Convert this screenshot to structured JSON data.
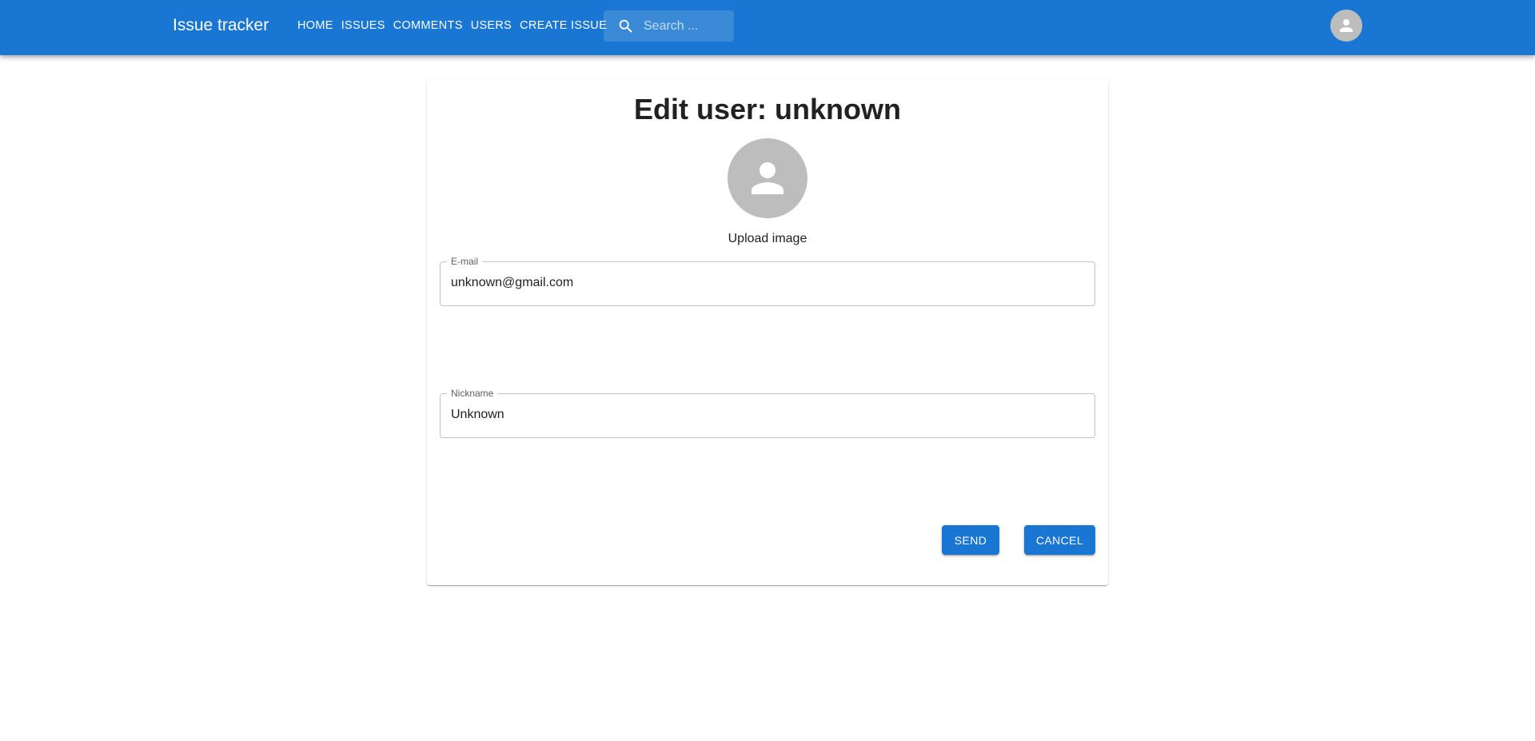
{
  "header": {
    "app_title": "Issue tracker",
    "nav": [
      {
        "label": "HOME"
      },
      {
        "label": "ISSUES"
      },
      {
        "label": "COMMENTS"
      },
      {
        "label": "USERS"
      },
      {
        "label": "CREATE ISSUE"
      }
    ],
    "search": {
      "placeholder": "Search ...",
      "value": "",
      "icon": "search-icon"
    },
    "account_icon": "person-icon"
  },
  "form": {
    "title": "Edit user: unknown",
    "avatar_icon": "person-icon",
    "upload_label": "Upload image",
    "email": {
      "label": "E-mail",
      "value": "unknown@gmail.com"
    },
    "nickname": {
      "label": "Nickname",
      "value": "Unknown"
    },
    "send_label": "SEND",
    "cancel_label": "CANCEL"
  },
  "colors": {
    "primary": "#1976d2",
    "avatar_bg": "#bdbdbd",
    "on_primary": "#ffffff"
  }
}
